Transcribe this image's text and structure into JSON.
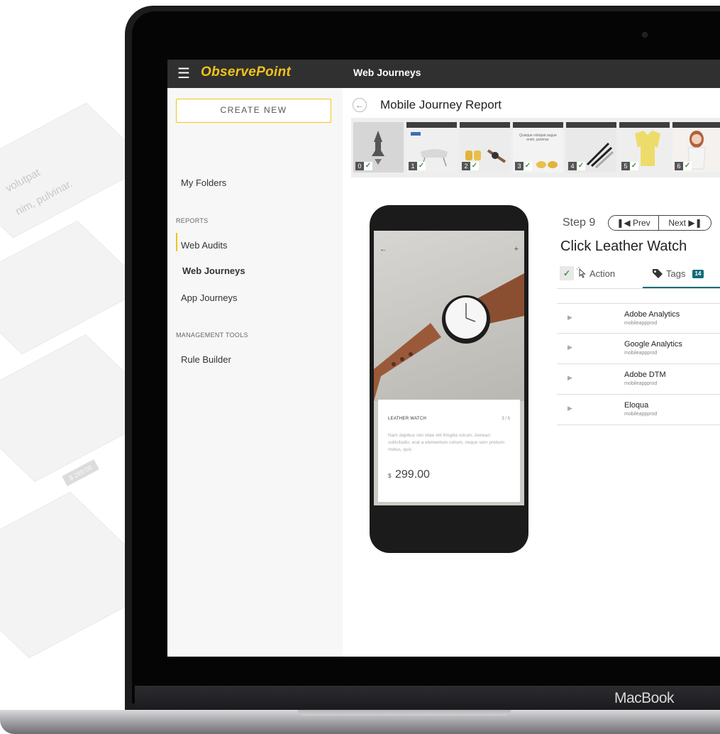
{
  "background": {
    "text_line_1": "volutpat",
    "text_line_2": "nim, pulvinar.",
    "price_tag": "$ 299.00"
  },
  "laptop": {
    "brand_label": "MacBook"
  },
  "app": {
    "logo_text": "ObservePoint",
    "section_title": "Web Journeys",
    "accent_color": "#f2c31a",
    "teal_color": "#136c78"
  },
  "sidebar": {
    "create_label": "CREATE NEW",
    "my_folders": "My Folders",
    "reports_heading": "REPORTS",
    "reports": [
      {
        "label": "Web Audits",
        "active": false
      },
      {
        "label": "Web Journeys",
        "active": true
      },
      {
        "label": "App Journeys",
        "active": false
      }
    ],
    "management_heading": "MANAGEMENT TOOLS",
    "rule_builder": "Rule Builder"
  },
  "main": {
    "back_icon": "arrow-left-icon",
    "report_title": "Mobile Journey Report",
    "thumbnails": [
      {
        "number": "0",
        "status": "pass"
      },
      {
        "number": "1",
        "status": "pass"
      },
      {
        "number": "2",
        "status": "pass"
      },
      {
        "number": "3",
        "status": "pass"
      },
      {
        "number": "4",
        "status": "pass"
      },
      {
        "number": "5",
        "status": "pass"
      },
      {
        "number": "6",
        "status": "pass"
      }
    ],
    "thumb3_text": "Quisque volutpat augue enim, pulvinar."
  },
  "phone": {
    "product_label": "LEATHER WATCH",
    "counter": "3 / 5",
    "description": "Nam dapibus nisl vitae elit fringilla rutrum. Aenean sollicitudin, erat a elementum rutrum, neque sem pretium metus, quis",
    "currency": "$",
    "price": "299.00"
  },
  "step": {
    "label": "Step 9",
    "prev_label": "Prev",
    "next_label": "Next",
    "title": "Click Leather Watch",
    "action_tab": "Action",
    "tags_tab": "Tags",
    "tags_count": "14"
  },
  "tags": [
    {
      "name": "Adobe Analytics",
      "account": "mobileappprod"
    },
    {
      "name": "Google Analytics",
      "account": "mobileappprod"
    },
    {
      "name": "Adobe DTM",
      "account": "mobileappprod"
    },
    {
      "name": "Eloqua",
      "account": "mobileappprod"
    }
  ]
}
